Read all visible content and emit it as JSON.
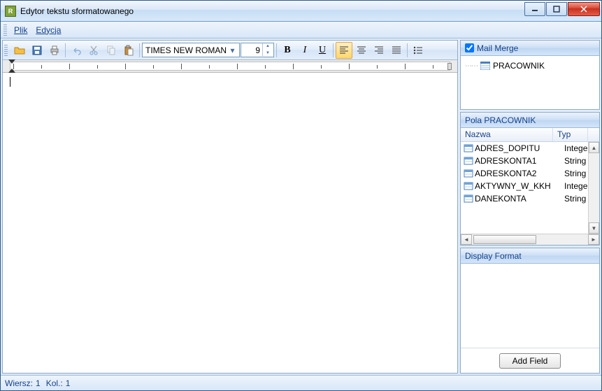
{
  "window": {
    "title": "Edytor tekstu sformatowanego"
  },
  "menu": {
    "file": "Plik",
    "edit": "Edycja"
  },
  "toolbar": {
    "font": "TIMES NEW ROMAN",
    "size": "9"
  },
  "status": {
    "row_label": "Wiersz:",
    "row_val": "1",
    "col_label": "Kol.:",
    "col_val": "1"
  },
  "mailmerge": {
    "label": "Mail Merge",
    "checked": true,
    "tree_root": "PRACOWNIK"
  },
  "fields_panel": {
    "title": "Pola PRACOWNIK",
    "col_name": "Nazwa",
    "col_type": "Typ",
    "rows": [
      {
        "name": "ADRES_DOPITU",
        "type": "Integer"
      },
      {
        "name": "ADRESKONTA1",
        "type": "String"
      },
      {
        "name": "ADRESKONTA2",
        "type": "String"
      },
      {
        "name": "AKTYWNY_W_KKH",
        "type": "Integer"
      },
      {
        "name": "DANEKONTA",
        "type": "String"
      }
    ]
  },
  "display_format": {
    "title": "Display Format"
  },
  "buttons": {
    "add_field": "Add Field"
  }
}
